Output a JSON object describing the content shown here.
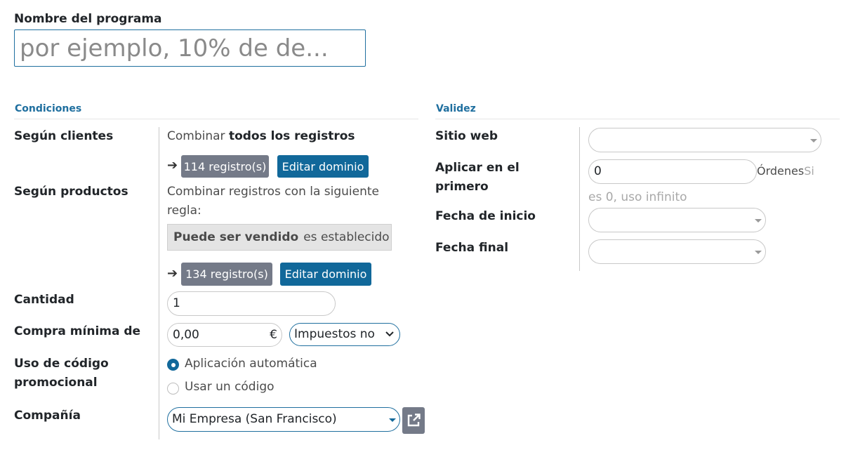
{
  "program_name": {
    "label": "Nombre del programa",
    "placeholder": "por ejemplo, 10% de de..."
  },
  "conditions": {
    "title": "Condiciones",
    "customers": {
      "label": "Según clientes",
      "combine_prefix": "Combinar",
      "combine_bold": "todos los registros",
      "records": "114 registro(s)",
      "edit_domain": "Editar dominio"
    },
    "products": {
      "label": "Según productos",
      "combine_line1": "Combinar registros con la siguiente",
      "combine_line2": "regla:",
      "rule_field": "Puede ser vendido",
      "rule_op": "es establecido",
      "records": "134 registro(s)",
      "edit_domain": "Editar dominio"
    },
    "quantity": {
      "label": "Cantidad",
      "value": "1"
    },
    "min_purchase": {
      "label": "Compra mínima de",
      "value": "0,00",
      "currency": "€",
      "tax_option": "Impuestos no"
    },
    "promo_code": {
      "label_line1": "Uso de código",
      "label_line2": "promocional",
      "options": [
        {
          "label": "Aplicación automática",
          "checked": true
        },
        {
          "label": "Usar un código",
          "checked": false
        }
      ]
    },
    "company": {
      "label": "Compañía",
      "value": "Mi Empresa (San Francisco)"
    }
  },
  "validity": {
    "title": "Validez",
    "website": {
      "label": "Sitio web",
      "value": ""
    },
    "apply_first": {
      "label_line1": "Aplicar en el",
      "label_line2": "primero",
      "value": "0",
      "unit": "Órdenes",
      "hint_line1": "Si",
      "hint_line2": "es 0, uso infinito"
    },
    "start_date": {
      "label": "Fecha de inicio",
      "value": ""
    },
    "end_date": {
      "label": "Fecha final",
      "value": ""
    }
  },
  "colors": {
    "accent": "#11689a",
    "badge": "#747a88",
    "section_title": "#1f6f9f"
  }
}
